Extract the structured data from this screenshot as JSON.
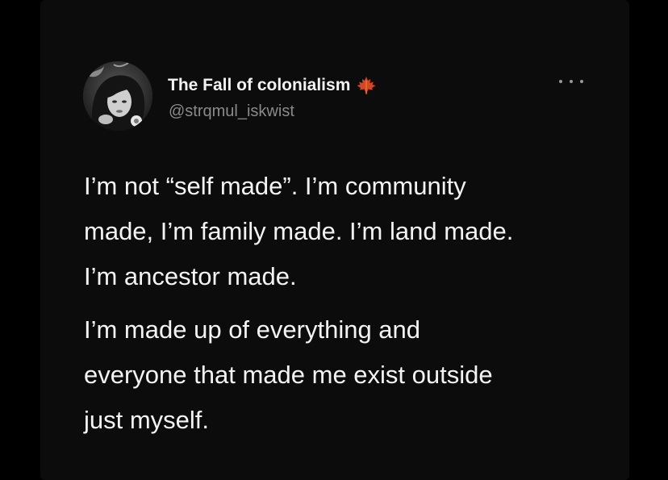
{
  "tweet": {
    "author": {
      "display_name": "The Fall of colonialism",
      "handle": "@strqmul_iskwist",
      "badge_icon": "maple-leaf-icon",
      "badge_color": "#d8461f"
    },
    "more_icon": "more-options-icon",
    "paragraphs": [
      "I’m not “self made”. I’m community\nmade, I’m family made. I’m land made.\nI’m ancestor made.",
      "I’m made up of everything and\neveryone that made me exist outside\njust myself."
    ]
  },
  "colors": {
    "background": "#000000",
    "card": "#0c0c0c",
    "text_primary": "#f3f3f3",
    "text_secondary": "#8a8a8a"
  }
}
